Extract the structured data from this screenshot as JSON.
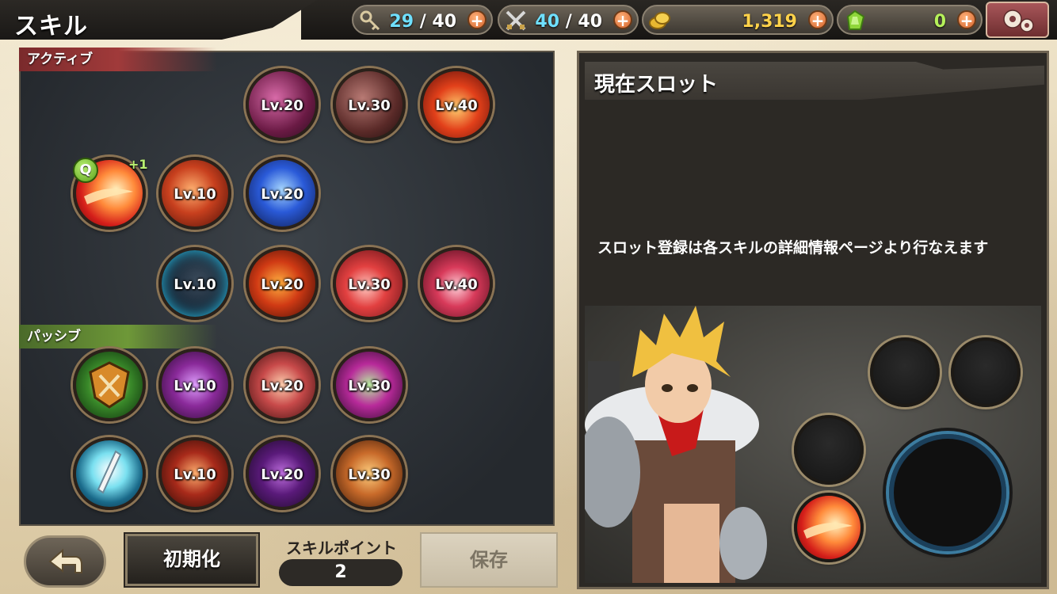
{
  "header": {
    "title": "スキル",
    "resources": {
      "keys": {
        "icon": "key-icon",
        "current": "29",
        "sep_max": " / 40"
      },
      "stamina": {
        "icon": "crossed-swords-icon",
        "current": "40",
        "sep_max": " / 40"
      },
      "gold": {
        "icon": "gold-coins-icon",
        "value": "1,319"
      },
      "gems": {
        "icon": "green-gem-icon",
        "value": "0"
      }
    },
    "plus": "+",
    "settings_icon": "gear-icon"
  },
  "skills": {
    "active_label": "アクティブ",
    "passive_label": "パッシブ",
    "quickslot_badge": "Q",
    "plus_badge": "+1",
    "active": [
      {
        "lv": "Lv.20",
        "theme": "purple-slash"
      },
      {
        "lv": "Lv.30",
        "theme": "dark-strike"
      },
      {
        "lv": "Lv.40",
        "theme": "fire-burst"
      },
      {
        "lv": "",
        "theme": "flame-wave"
      },
      {
        "lv": "Lv.10",
        "theme": "fire-slash"
      },
      {
        "lv": "Lv.20",
        "theme": "blue-lightning"
      },
      {
        "lv": "Lv.10",
        "theme": "blue-shadow"
      },
      {
        "lv": "Lv.20",
        "theme": "fire-figure"
      },
      {
        "lv": "Lv.30",
        "theme": "red-impact"
      },
      {
        "lv": "Lv.40",
        "theme": "crimson-burst"
      }
    ],
    "passive": [
      {
        "lv": "",
        "theme": "green-shield"
      },
      {
        "lv": "Lv.10",
        "theme": "purple-aura"
      },
      {
        "lv": "Lv.20",
        "theme": "crossed-slash"
      },
      {
        "lv": "Lv.30",
        "theme": "purple-orb"
      },
      {
        "lv": "",
        "theme": "sword-light"
      },
      {
        "lv": "Lv.10",
        "theme": "fist-fire"
      },
      {
        "lv": "Lv.20",
        "theme": "purple-figure"
      },
      {
        "lv": "Lv.30",
        "theme": "orange-shield"
      }
    ]
  },
  "bottom": {
    "back_icon": "back-arrow-icon",
    "reset_label": "初期化",
    "skill_point_label": "スキルポイント",
    "skill_point_value": "2",
    "save_label": "保存"
  },
  "slot_panel": {
    "title": "現在スロット",
    "info": "スロット登録は各スキルの詳細情報ページより行なえます"
  },
  "colors": {
    "accent_cyan": "#6fe0ff",
    "gold": "#ffd24a",
    "gem_green": "#b5f05a",
    "active_red": "#a03a3a",
    "passive_green": "#6e9838"
  }
}
